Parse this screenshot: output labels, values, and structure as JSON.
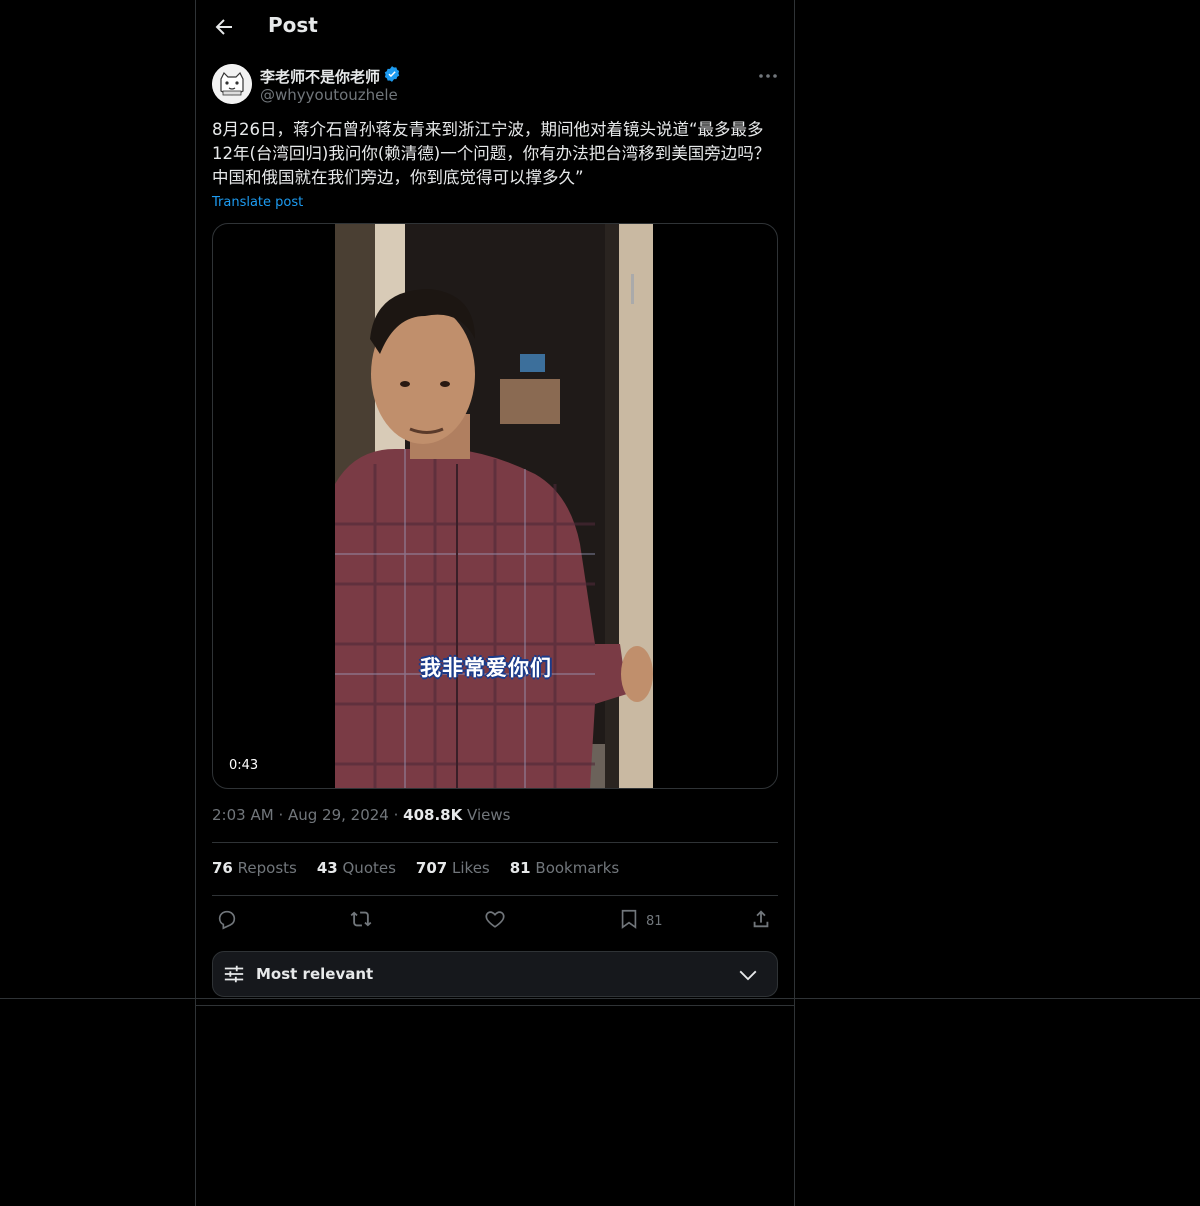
{
  "header": {
    "title": "Post"
  },
  "author": {
    "name": "李老师不是你老师",
    "handle": "@whyyoutouzhele"
  },
  "post": {
    "text": "8月26日，蒋介石曾孙蒋友青来到浙江宁波，期间他对着镜头说道“最多最多12年(台湾回归)我问你(赖清德)一个问题，你有办法把台湾移到美国旁边吗？中国和俄国就在我们旁边，你到底觉得可以撑多久”",
    "translate_label": "Translate post",
    "video_duration": "0:43",
    "video_caption": "我非常爱你们",
    "time": "2:03 AM",
    "date": "Aug 29, 2024",
    "views_count": "408.8K",
    "views_label": "Views"
  },
  "stats": {
    "reposts_count": "76",
    "reposts_label": "Reposts",
    "quotes_count": "43",
    "quotes_label": "Quotes",
    "likes_count": "707",
    "likes_label": "Likes",
    "bookmarks_count": "81",
    "bookmarks_label": "Bookmarks"
  },
  "actions": {
    "bookmark_count": "81"
  },
  "sort": {
    "label": "Most relevant"
  },
  "colors": {
    "accent": "#1d9bf0",
    "background": "#000000",
    "muted": "#71767b",
    "border": "#2f3336"
  }
}
